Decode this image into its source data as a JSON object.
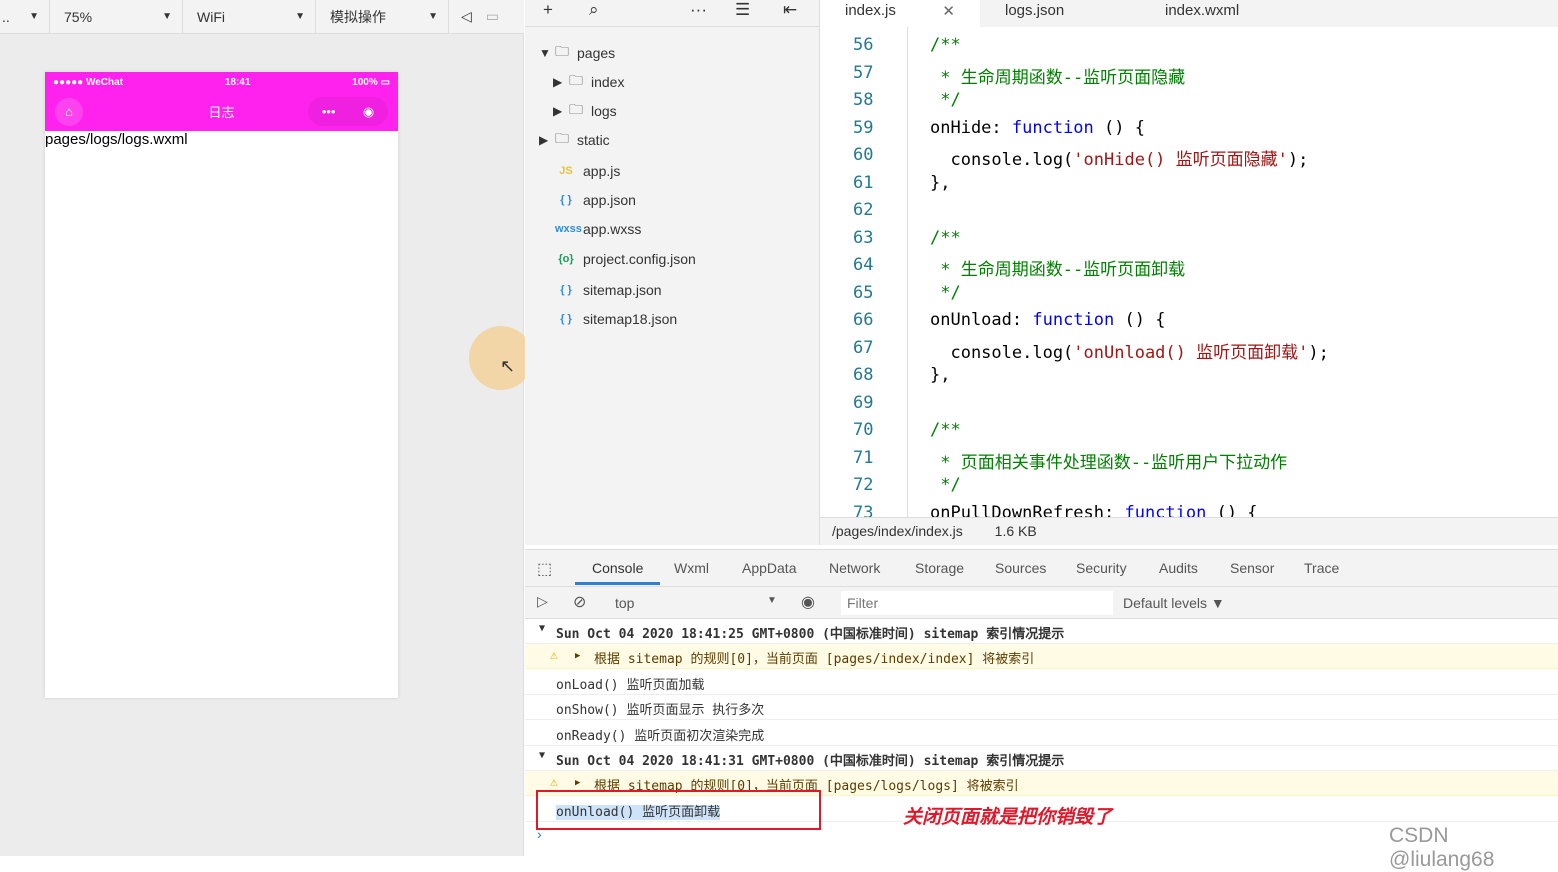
{
  "simulator": {
    "toolbar": {
      "device": "..",
      "zoom": "75%",
      "network": "WiFi",
      "operation": "模拟操作"
    },
    "phone": {
      "carrier": "●●●●● WeChat",
      "time": "18:41",
      "battery": "100%",
      "title": "日志",
      "content": "pages/logs/logs.wxml",
      "nav_color": "#ff22ee"
    }
  },
  "file_tree": {
    "items": [
      {
        "label": "pages",
        "type": "folder-open",
        "icon": "▾"
      },
      {
        "label": "index",
        "type": "folder",
        "icon": "▸"
      },
      {
        "label": "logs",
        "type": "folder",
        "icon": "▸"
      },
      {
        "label": "static",
        "type": "folder",
        "icon": "▸"
      },
      {
        "label": "app.js",
        "badge": "JS",
        "color": "#e8c23c"
      },
      {
        "label": "app.json",
        "badge": "{ }",
        "color": "#2f8cd6"
      },
      {
        "label": "app.wxss",
        "badge": "wxss",
        "color": "#2f8cd6"
      },
      {
        "label": "project.config.json",
        "badge": "{o}",
        "color": "#1a9c5a"
      },
      {
        "label": "sitemap.json",
        "badge": "{ }",
        "color": "#2f8cd6"
      },
      {
        "label": "sitemap18.json",
        "badge": "{ }",
        "color": "#2f8cd6"
      }
    ]
  },
  "editor": {
    "tabs": [
      "index.js",
      "logs.json",
      "index.wxml"
    ],
    "lines": [
      {
        "n": "56",
        "seg": [
          [
            "c-comment",
            "/**"
          ]
        ]
      },
      {
        "n": "57",
        "seg": [
          [
            "c-comment",
            " * 生命周期函数--监听页面隐藏"
          ]
        ]
      },
      {
        "n": "58",
        "seg": [
          [
            "c-comment",
            " */"
          ]
        ]
      },
      {
        "n": "59",
        "seg": [
          [
            "c-plain",
            "onHide: "
          ],
          [
            "c-kw",
            "function"
          ],
          [
            "c-plain",
            " () {"
          ]
        ]
      },
      {
        "n": "60",
        "seg": [
          [
            "c-plain",
            "  console.log("
          ],
          [
            "c-str",
            "'onHide() 监听页面隐藏'"
          ],
          [
            "c-plain",
            ");"
          ]
        ]
      },
      {
        "n": "61",
        "seg": [
          [
            "c-plain",
            "},"
          ]
        ]
      },
      {
        "n": "62",
        "seg": []
      },
      {
        "n": "63",
        "seg": [
          [
            "c-comment",
            "/**"
          ]
        ]
      },
      {
        "n": "64",
        "seg": [
          [
            "c-comment",
            " * 生命周期函数--监听页面卸载"
          ]
        ]
      },
      {
        "n": "65",
        "seg": [
          [
            "c-comment",
            " */"
          ]
        ]
      },
      {
        "n": "66",
        "seg": [
          [
            "c-plain",
            "onUnload: "
          ],
          [
            "c-kw",
            "function"
          ],
          [
            "c-plain",
            " () {"
          ]
        ]
      },
      {
        "n": "67",
        "seg": [
          [
            "c-plain",
            "  console.log("
          ],
          [
            "c-str",
            "'onUnload() 监听页面卸载'"
          ],
          [
            "c-plain",
            ");"
          ]
        ]
      },
      {
        "n": "68",
        "seg": [
          [
            "c-plain",
            "},"
          ]
        ]
      },
      {
        "n": "69",
        "seg": []
      },
      {
        "n": "70",
        "seg": [
          [
            "c-comment",
            "/**"
          ]
        ]
      },
      {
        "n": "71",
        "seg": [
          [
            "c-comment",
            " * 页面相关事件处理函数--监听用户下拉动作"
          ]
        ]
      },
      {
        "n": "72",
        "seg": [
          [
            "c-comment",
            " */"
          ]
        ]
      },
      {
        "n": "73",
        "seg": [
          [
            "c-plain",
            "onPullDownRefresh: "
          ],
          [
            "c-kw",
            "function"
          ],
          [
            "c-plain",
            " () {"
          ]
        ]
      }
    ],
    "status": {
      "path": "/pages/index/index.js",
      "size": "1.6 KB"
    }
  },
  "devtools": {
    "tabs": [
      "Console",
      "Wxml",
      "AppData",
      "Network",
      "Storage",
      "Sources",
      "Security",
      "Audits",
      "Sensor",
      "Trace"
    ],
    "context": "top",
    "filter_placeholder": "Filter",
    "levels": "Default levels ▼",
    "rows": [
      {
        "kind": "grp",
        "text": "Sun Oct 04 2020 18:41:25 GMT+0800 (中国标准时间) sitemap 索引情况提示"
      },
      {
        "kind": "warn",
        "text": "根据 sitemap 的规则[0]，当前页面 [pages/index/index] 将被索引"
      },
      {
        "kind": "log",
        "text": "onLoad() 监听页面加载"
      },
      {
        "kind": "log",
        "text": "onShow() 监听页面显示 执行多次"
      },
      {
        "kind": "log",
        "text": "onReady() 监听页面初次渲染完成"
      },
      {
        "kind": "grp",
        "text": "Sun Oct 04 2020 18:41:31 GMT+0800 (中国标准时间) sitemap 索引情况提示"
      },
      {
        "kind": "warn",
        "text": "根据 sitemap 的规则[0]，当前页面 [pages/logs/logs] 将被索引"
      },
      {
        "kind": "log",
        "text": "onUnload() 监听页面卸载"
      }
    ],
    "annotation": "关闭页面就是把你销毁了",
    "watermark": "CSDN @liulang68"
  }
}
